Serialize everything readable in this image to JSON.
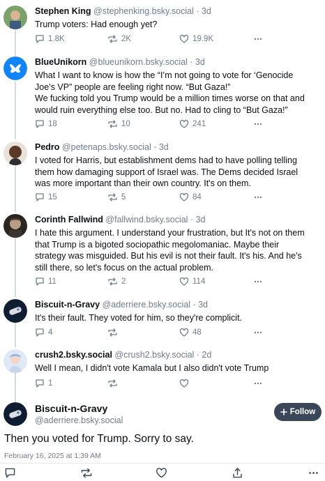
{
  "posts": [
    {
      "name": "Stephen King",
      "handle": "@stephenking.bsky.social",
      "time": "· 3d",
      "lines": [
        "Trump voters: Had enough yet?"
      ],
      "replies": "1.8K",
      "reposts": "2K",
      "likes": "19.9K"
    },
    {
      "name": "BlueUnikorn",
      "handle": "@blueunikorn.bsky.social",
      "time": "· 3d",
      "lines": [
        "What I want to know is how the “I’m not going to vote for ‘Genocide",
        "Joe’s VP” people are feeling right now. “But Gaza!”",
        "We fucking told you Trump would be a million times worse on that and",
        "would ruin everything else too. But no. Had to cling to “But Gaza!”"
      ],
      "replies": "18",
      "reposts": "10",
      "likes": "241"
    },
    {
      "name": "Pedro",
      "handle": "@petenaps.bsky.social",
      "time": "· 3d",
      "lines": [
        "I voted for Harris, but establishment dems had to have polling telling",
        "them how damaging support of Israel was. The Dems decided Israel",
        "was more important than their own country. It's on them."
      ],
      "replies": "15",
      "reposts": "5",
      "likes": "84"
    },
    {
      "name": "Corinth Fallwind",
      "handle": "@fallwind.bsky.social",
      "time": "· 3d",
      "lines": [
        "I hate this argument.  I understand your frustration,  but It's not on them",
        "that Trump is a bigoted sociopathic megolomaniac. Maybe their",
        "strategy was misguided. But his evil is not their fault. It's his. And he's",
        "still there, so let's focus on the actual problem."
      ],
      "replies": "11",
      "reposts": "2",
      "likes": "114"
    },
    {
      "name": "Biscuit-n-Gravy",
      "handle": "@aderriere.bsky.social",
      "time": "· 3d",
      "lines": [
        "It's their fault. They voted for him, so they're complicit."
      ],
      "replies": "4",
      "reposts": "",
      "likes": "48"
    },
    {
      "name": "crush2.bsky.social",
      "handle": "@crush2.bsky.social",
      "time": "· 2d",
      "lines": [
        "Well I mean, I didn't vote Kamala but I also didn't vote Trump"
      ],
      "replies": "1",
      "reposts": "",
      "likes": ""
    }
  ],
  "main_post": {
    "name": "Biscuit-n-Gravy",
    "handle": "@aderriere.bsky.social",
    "follow_label": "Follow",
    "text": "Then you voted for Trump. Sorry to say.",
    "date": "February 16, 2025 at 1:39 AM"
  },
  "icons": {
    "reply": "speech-bubble-icon",
    "repost": "repost-arrows-icon",
    "like": "heart-icon",
    "more": "ellipsis-icon",
    "share": "share-icon",
    "plus": "plus-icon"
  },
  "colors": {
    "muted": "#6f7d8c",
    "follow_button": "#3b4758",
    "bluesky_blue": "#1185fe"
  }
}
